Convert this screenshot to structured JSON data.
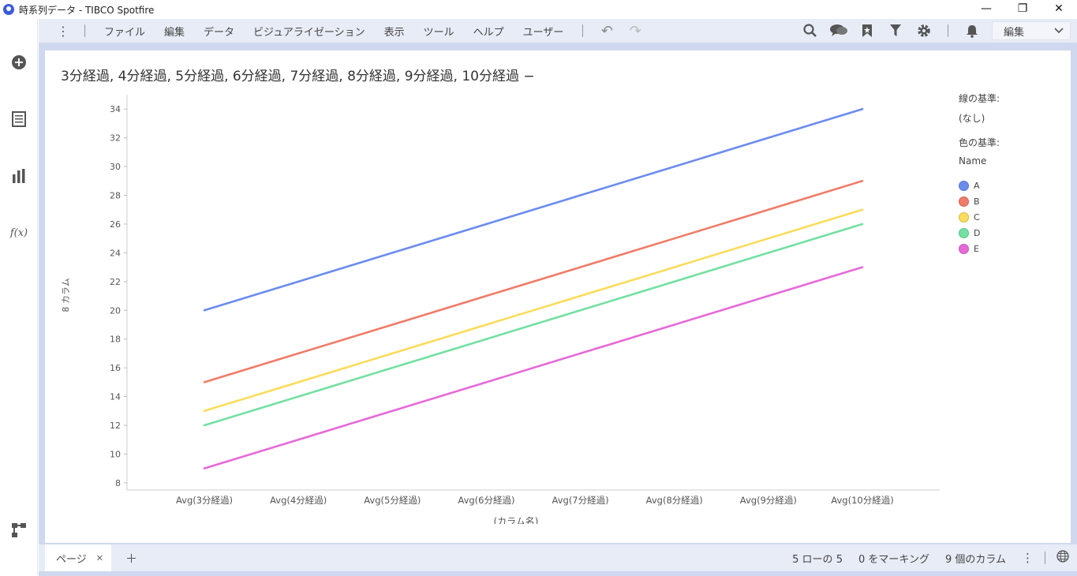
{
  "window": {
    "title": "時系列データ - TIBCO Spotfire",
    "minimize": "—",
    "restore": "❐",
    "close": "✕"
  },
  "menubar": {
    "more": "⋮",
    "items": [
      "ファイル",
      "編集",
      "データ",
      "ビジュアライゼーション",
      "表示",
      "ツール",
      "ヘルプ",
      "ユーザー"
    ],
    "undo": "↶",
    "redo": "↷",
    "edit_mode": "編集",
    "icons": [
      "search-icon",
      "comments-icon",
      "bookmark-icon",
      "filter-icon",
      "settings-icon",
      "notification-icon"
    ]
  },
  "leftbar": {
    "icons": [
      "add-icon",
      "data-table-icon",
      "visualization-icon",
      "expression-icon",
      "data-canvas-icon"
    ],
    "fx": "f(x)"
  },
  "visualization": {
    "title": "3分経過, 4分経過, 5分経過, 6分経過, 7分経過, 8分経過, 9分経過, 10分経過 −",
    "legend": {
      "line_by_label": "線の基準:",
      "line_by_value": "(なし)",
      "color_by_label": "色の基準:",
      "color_by_value": "Name",
      "items": [
        {
          "name": "A",
          "color": "#6b8cef"
        },
        {
          "name": "B",
          "color": "#f07b68"
        },
        {
          "name": "C",
          "color": "#fbdc5b"
        },
        {
          "name": "D",
          "color": "#74e0a2"
        },
        {
          "name": "E",
          "color": "#e66ad8"
        }
      ]
    }
  },
  "chart_data": {
    "type": "line",
    "categories": [
      "Avg(3分経過)",
      "Avg(4分経過)",
      "Avg(5分経過)",
      "Avg(6分経過)",
      "Avg(7分経過)",
      "Avg(8分経過)",
      "Avg(9分経過)",
      "Avg(10分経過)"
    ],
    "series": [
      {
        "name": "A",
        "color": "#6b8cef",
        "values": [
          20,
          22,
          24,
          26,
          28,
          30,
          32,
          34
        ]
      },
      {
        "name": "B",
        "color": "#f07b68",
        "values": [
          15,
          17,
          19,
          21,
          23,
          25,
          27,
          29
        ]
      },
      {
        "name": "C",
        "color": "#fbdc5b",
        "values": [
          13,
          15,
          17,
          19,
          21,
          23,
          25,
          27
        ]
      },
      {
        "name": "D",
        "color": "#74e0a2",
        "values": [
          12,
          14,
          16,
          18,
          20,
          22,
          24,
          26
        ]
      },
      {
        "name": "E",
        "color": "#e66ad8",
        "values": [
          9,
          11,
          13,
          15,
          17,
          19,
          21,
          23
        ]
      }
    ],
    "yticks": [
      8,
      10,
      12,
      14,
      16,
      18,
      20,
      22,
      24,
      26,
      28,
      30,
      32,
      34
    ],
    "ylim": [
      7.5,
      35
    ],
    "xlabel": "(カラム名)",
    "ylabel": "8 カラム",
    "grid": false,
    "legend": "right"
  },
  "statusbar": {
    "page_tab": "ページ",
    "close_tab": "✕",
    "add_page": "＋",
    "rows": "5 ローの 5",
    "marking": "0 をマーキング",
    "columns": "9 個のカラム",
    "more": "⋮"
  }
}
